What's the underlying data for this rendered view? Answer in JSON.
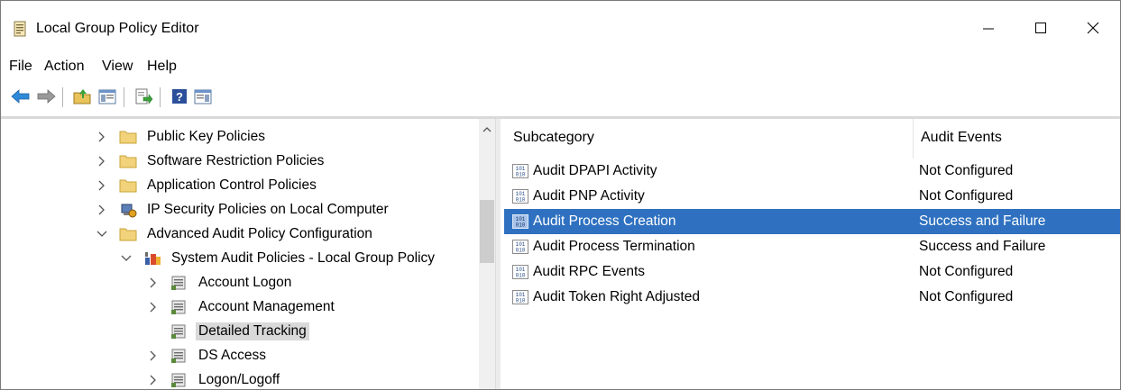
{
  "window": {
    "title": "Local Group Policy Editor",
    "icon": "policy-editor-icon",
    "controls": [
      "minimize-icon",
      "maximize-icon",
      "close-icon"
    ]
  },
  "menu": [
    "File",
    "Action",
    "View",
    "Help"
  ],
  "toolbar": [
    "back-arrow-icon",
    "forward-arrow-icon",
    "up-folder-icon",
    "show-hide-tree-icon",
    "export-list-icon",
    "help-icon",
    "properties-pane-icon"
  ],
  "tree": [
    {
      "label": "Public Key Policies",
      "icon": "folder-icon",
      "expanded": false
    },
    {
      "label": "Software Restriction Policies",
      "icon": "folder-icon",
      "expanded": false
    },
    {
      "label": "Application Control Policies",
      "icon": "folder-icon",
      "expanded": false
    },
    {
      "label": "IP Security Policies on Local Computer",
      "icon": "security-policy-icon",
      "expanded": false
    },
    {
      "label": "Advanced Audit Policy Configuration",
      "icon": "folder-icon",
      "expanded": true
    },
    {
      "label": "System Audit Policies - Local Group Policy",
      "icon": "audit-policy-icon",
      "expanded": true
    },
    {
      "label": "Account Logon",
      "icon": "policy-node-icon",
      "expanded": false
    },
    {
      "label": "Account Management",
      "icon": "policy-node-icon",
      "expanded": false
    },
    {
      "label": "Detailed Tracking",
      "icon": "policy-node-icon",
      "selected": true
    },
    {
      "label": "DS Access",
      "icon": "policy-node-icon",
      "expanded": false
    },
    {
      "label": "Logon/Logoff",
      "icon": "policy-node-icon",
      "expanded": false
    }
  ],
  "list": {
    "headers": {
      "subcategory": "Subcategory",
      "audit_events": "Audit Events"
    },
    "rows": [
      {
        "subcategory": "Audit DPAPI Activity",
        "audit_events": "Not Configured"
      },
      {
        "subcategory": "Audit PNP Activity",
        "audit_events": "Not Configured"
      },
      {
        "subcategory": "Audit Process Creation",
        "audit_events": "Success and Failure",
        "selected": true
      },
      {
        "subcategory": "Audit Process Termination",
        "audit_events": "Success and Failure"
      },
      {
        "subcategory": "Audit RPC Events",
        "audit_events": "Not Configured"
      },
      {
        "subcategory": "Audit Token Right Adjusted",
        "audit_events": "Not Configured"
      }
    ]
  },
  "colors": {
    "selection": "#2f71c0",
    "tree_selection": "#d9d9d9"
  }
}
